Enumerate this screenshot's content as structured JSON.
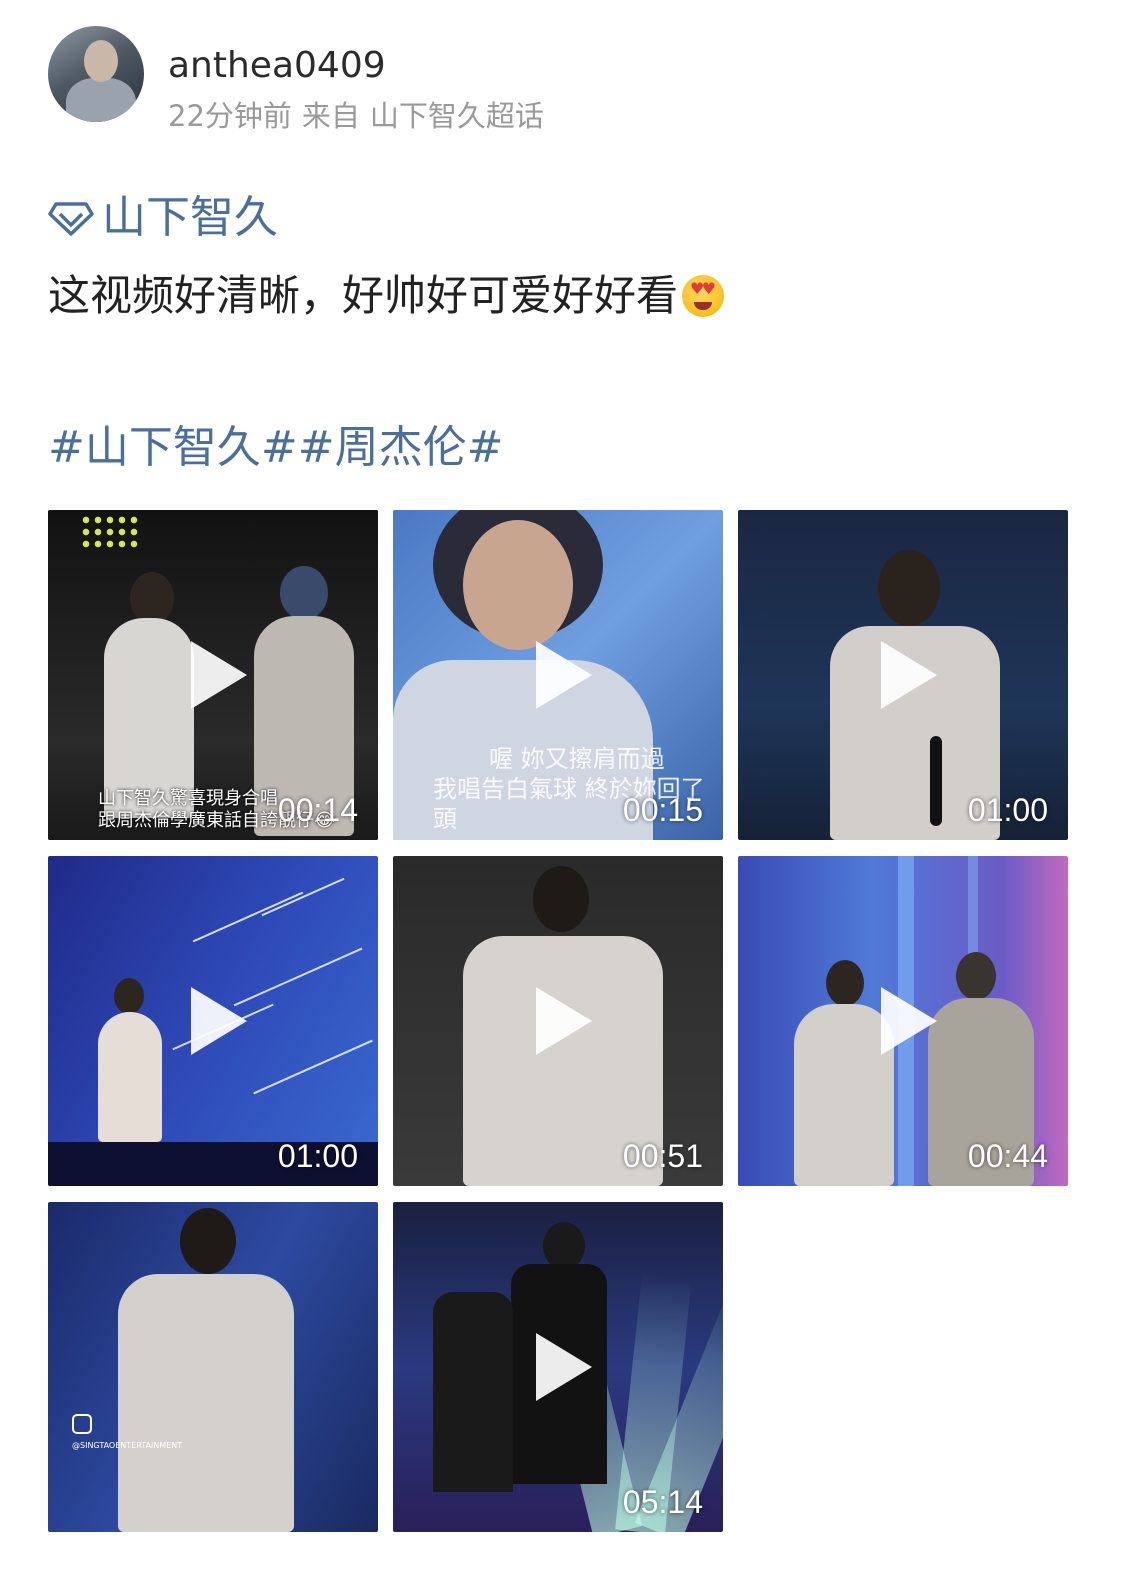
{
  "post": {
    "username": "anthea0409",
    "time": "22分钟前",
    "source_prefix": "来自",
    "source": "山下智久超话",
    "topic_label": "山下智久",
    "text": "这视频好清晰，好帅好可爱好好看",
    "emoji": "heart-eyes-emoji",
    "hashtags": "#山下智久##周杰伦#"
  },
  "videos": [
    {
      "duration": "00:14",
      "caption_line1": "山下智久驚喜現身合唱",
      "caption_line2": "跟周杰倫學廣東話自誇靚仔😂"
    },
    {
      "duration": "00:15",
      "subtitle_line1": "喔 妳又擦肩而過",
      "subtitle_line2": "我唱告白氣球 終於妳回了頭"
    },
    {
      "duration": "01:00"
    },
    {
      "duration": "01:00"
    },
    {
      "duration": "00:51"
    },
    {
      "duration": "00:44"
    },
    {
      "duration": "",
      "watermark": "@SINGTAOENTERTAINMENT"
    },
    {
      "duration": "05:14"
    }
  ],
  "colors": {
    "link": "#4a6f9c",
    "meta": "#9a9a9a"
  }
}
